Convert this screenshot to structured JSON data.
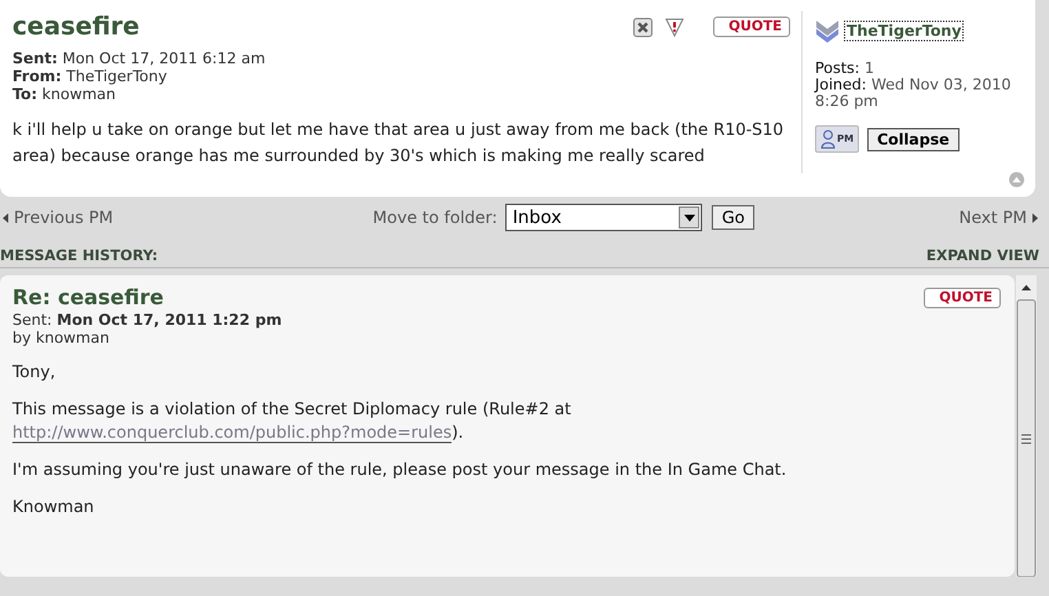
{
  "message": {
    "title": "ceasefire",
    "quote": "QUOTE",
    "meta": [
      {
        "label": "Sent:",
        "value": "Mon Oct 17, 2011 6:12 am"
      },
      {
        "label": "From:",
        "value": "TheTigerTony"
      },
      {
        "label": "To:",
        "value": "knowman"
      }
    ],
    "body": "k i'll help u take on orange but let me have that area u just away from me back (the R10-S10 area) because orange has me surrounded by 30's which is making me really scared"
  },
  "author": {
    "name": "TheTigerTony",
    "stats": [
      {
        "label": "Posts:",
        "value": "1"
      },
      {
        "label": "Joined:",
        "value": "Wed Nov 03, 2010 8:26 pm"
      }
    ],
    "pm": "PM",
    "collapse": "Collapse"
  },
  "nav": {
    "previous": "Previous PM",
    "folder_label": "Move to folder:",
    "folder": "Inbox",
    "go": "Go",
    "next": "Next PM"
  },
  "history": {
    "label": "MESSAGE HISTORY:",
    "expand": "EXPAND VIEW",
    "messages": [
      {
        "title": "Re: ceasefire",
        "quote": "QUOTE",
        "sent_label": "Sent:",
        "sent": "Mon Oct 17, 2011 1:22 pm",
        "by": "by knowman",
        "paragraphs": [
          {
            "kind": "text",
            "text": "Tony,"
          },
          {
            "kind": "link",
            "before": "This message is a violation of the Secret Diplomacy rule (Rule#2 at ",
            "link": "http://www.conquerclub.com/public.php?mode=rules",
            "after": ")."
          },
          {
            "kind": "text",
            "text": "I'm assuming you're just unaware of the rule, please post your message in the In Game Chat."
          },
          {
            "kind": "text",
            "text": "Knowman"
          }
        ]
      }
    ]
  }
}
